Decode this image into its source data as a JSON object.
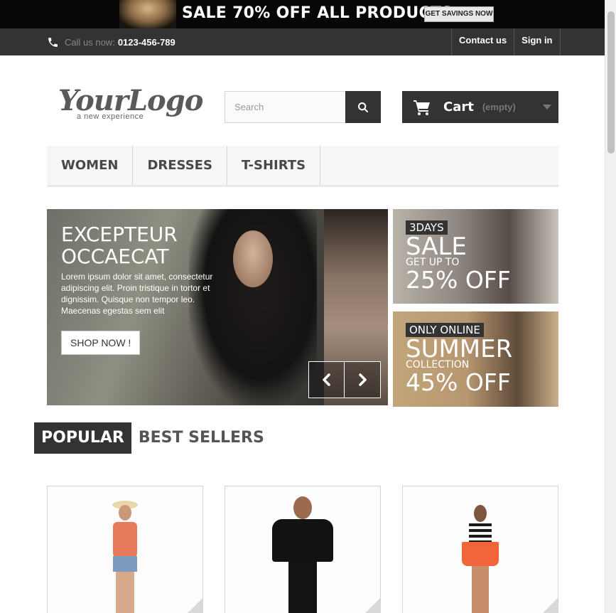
{
  "promo": {
    "headline": "SALE 70% OFF ALL PRODUCTS",
    "button_label": "GET SAVINGS NOW"
  },
  "topbar": {
    "phone_prefix": "Call us now:",
    "phone_number": "0123-456-789",
    "links": [
      "Contact us",
      "Sign in"
    ]
  },
  "header": {
    "logo_text": "YourLogo",
    "logo_tagline": "a new experience",
    "search_placeholder": "Search",
    "cart_label": "Cart",
    "cart_status": "(empty)"
  },
  "menu": {
    "items": [
      "WOMEN",
      "DRESSES",
      "T-SHIRTS"
    ]
  },
  "slider": {
    "title_line1": "EXCEPTEUR",
    "title_line2": "OCCAECAT",
    "description": "Lorem ipsum dolor sit amet, consectetur adipiscing elit. Proin tristique in tortor et dignissim. Quisque non tempor leo. Maecenas egestas sem elit",
    "button_label": "SHOP NOW !"
  },
  "banners": [
    {
      "tag": "3DAYS",
      "headline": "SALE",
      "subline": "GET UP TO",
      "offer": "25% OFF"
    },
    {
      "tag": "ONLY ONLINE",
      "headline": "SUMMER",
      "subline": "COLLECTION",
      "offer": "45% OFF"
    }
  ],
  "tabs": {
    "items": [
      "POPULAR",
      "BEST SELLERS"
    ],
    "active": "POPULAR"
  },
  "colors": {
    "dark": "#333333",
    "promo_bg": "#070707",
    "menu_bg": "#f6f6f6"
  }
}
